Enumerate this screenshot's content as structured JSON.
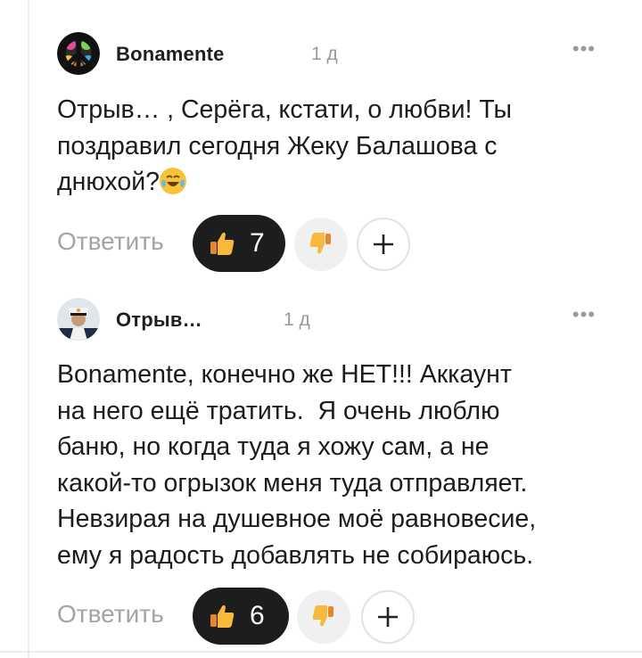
{
  "comments": [
    {
      "author": "Bonamente",
      "time": "1 д",
      "more_label": "•••",
      "text_lines": [
        "Отрыв… , Серёга, кстати, о любви! Ты",
        "поздравил сегодня Жеку Балашова с",
        "днюхой?"
      ],
      "emoji_icon": "laughing-tears-emoji",
      "reply_label": "Ответить",
      "likes": "7",
      "avatar_icon": "peace-sign-avatar"
    },
    {
      "author": "Отрыв…",
      "time": "1 д",
      "more_label": "•••",
      "text_lines": [
        "Bonamente, конечно же НЕТ!!! Аккаунт",
        "на него ещё тратить.  Я очень люблю",
        "баню, но когда туда я хожу сам, а не",
        "какой-то огрызок меня туда отправляет.",
        "Невзирая на душевное моё равновесие,",
        "ему я радость добавлять не собираюсь."
      ],
      "reply_label": "Ответить",
      "likes": "6",
      "avatar_icon": "sailor-avatar"
    }
  ],
  "icons": {
    "like": "thumbs-up-icon",
    "dislike": "thumbs-down-icon",
    "add": "plus-icon"
  },
  "colors": {
    "like_button_bg": "#1d1d1d",
    "dislike_button_bg": "#f0f0f0",
    "muted_text": "#9a9a9a",
    "thumb_yellow": "#f6b93b"
  }
}
